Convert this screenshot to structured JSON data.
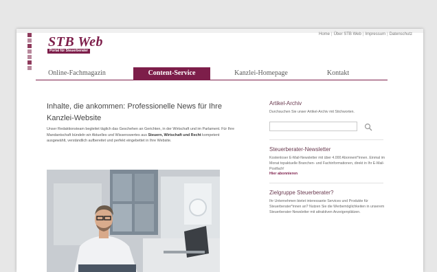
{
  "header": {
    "logo_title": "STB Web",
    "logo_subtitle": "Portal für Steuerberater",
    "top_links": [
      "Home",
      "Über STB Web",
      "Impressum",
      "Datenschutz"
    ]
  },
  "nav": {
    "items": [
      "Online-Fachmagazin",
      "Content-Service",
      "Kanzlei-Homepage",
      "Kontakt"
    ],
    "active_index": 1
  },
  "main": {
    "headline": "Inhalte, die ankommen: Professionelle News für Ihre Kanzlei-Website",
    "intro_part1": "Unser Redaktionsteam begleitet täglich das Geschehen an Gerichten, in der Wirtschaft und im Parlament. Für Ihre Mandantschaft bündeln wir Aktuelles und Wissenswertes aus",
    "intro_bold": "Steuern, Wirtschaft und Recht",
    "intro_part2": "kompetent ausgewählt, verständlich aufbereitet und perfekt eingebettet in Ihre Website."
  },
  "sidebar": {
    "archive": {
      "heading": "Artikel-Archiv",
      "text": "Durchsuchen Sie unser Artikel-Archiv mit Stichworten.",
      "search_value": ""
    },
    "newsletter": {
      "heading": "Steuerberater-Newsletter",
      "text": "Kostenloser E-Mail-Newsletter mit über 4.000 Abonnent*innen. Einmal im Monat topaktuelle Branchen- und Fachinformationen, direkt in Ihr E-Mail-Postfach!",
      "link": "Hier abonnieren"
    },
    "target": {
      "heading": "Zielgruppe Steuerberater?",
      "text": "Ihr Unternehmen bietet interessante Services und Produkte für Steuerberater*innen an? Nutzen Sie die Werbemöglichkeiten in unserem Steuerberater-Newsletter mit attraktiven Anzeigenplätzen."
    }
  },
  "colors": {
    "brand": "#7d1e4a",
    "background": "#e7e7e7",
    "text": "#444444"
  }
}
